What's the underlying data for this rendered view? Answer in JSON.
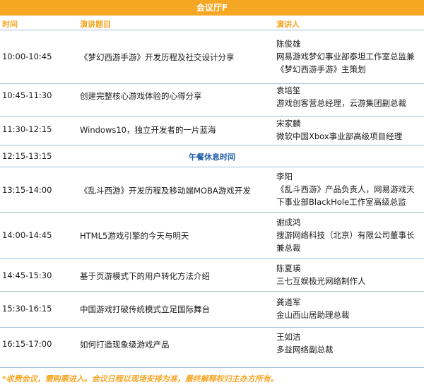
{
  "hall_title": "会议厅F",
  "headers": {
    "time": "时间",
    "topic": "演讲题目",
    "speaker": "演讲人"
  },
  "sessions": [
    {
      "time": "10:00-10:45",
      "topic": "《梦幻西游手游》开发历程及社交设计分享",
      "speaker_name": "陈俊雄",
      "speaker_title": "网易游戏梦幻事业部泰坦工作室总监兼《梦幻西游手游》主策划"
    },
    {
      "time": "10:45-11:30",
      "topic": "创建完整核心游戏体验的心得分享",
      "speaker_name": "袁培笙",
      "speaker_title": "游戏创客营总经理，云游集团副总裁"
    },
    {
      "time": "11:30-12:15",
      "topic": "Windows10，独立开发者的一片蓝海",
      "speaker_name": "宋家麟",
      "speaker_title": "微软中国Xbox事业部高级项目经理"
    },
    {
      "time": "12:15-13:15",
      "topic": "午餐休息时间",
      "speaker_name": "",
      "speaker_title": ""
    },
    {
      "time": "13:15-14:00",
      "topic": "《乱斗西游》开发历程及移动端MOBA游戏开发",
      "speaker_name": "李阳",
      "speaker_title": "《乱斗西游》产品负责人，网易游戏天下事业部BlackHole工作室高级总监"
    },
    {
      "time": "14:00-14:45",
      "topic": "HTML5游戏引擎的今天与明天",
      "speaker_name": "谢成鸿",
      "speaker_title": "搜游网络科技（北京）有限公司董事长兼总裁"
    },
    {
      "time": "14:45-15:30",
      "topic": "基于页游模式下的用户转化方法介绍",
      "speaker_name": "陈夏瑛",
      "speaker_title": "三七互娱极光网络制作人"
    },
    {
      "time": "15:30-16:15",
      "topic": "中国游戏打破传统模式立足国际舞台",
      "speaker_name": "龚道军",
      "speaker_title": "金山西山居助理总裁"
    },
    {
      "time": "16:15-17:00",
      "topic": "如何打造现象级游戏产品",
      "speaker_name": "王如洁",
      "speaker_title": "多益网络副总裁"
    }
  ],
  "footnote": "*收费会议，需购票进入。会议日程以现场安排为准，最终解释权归主办方所有。",
  "colors": {
    "accent": "#f5a623",
    "lunch_text": "#1f5fa8",
    "divider": "#9fbad6"
  }
}
